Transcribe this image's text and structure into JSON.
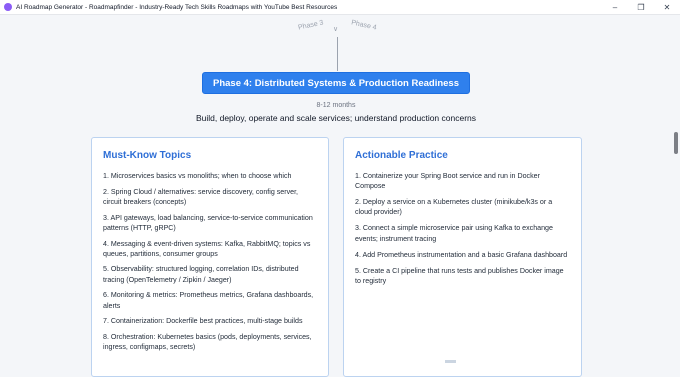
{
  "window": {
    "title": "AI Roadmap Generator - Roadmapfinder - Industry-Ready Tech Skills Roadmaps with YouTube Best Resources",
    "controls": {
      "minimize": "–",
      "maximize": "❐",
      "close": "✕"
    }
  },
  "phase_nav": {
    "previous": "Phase 3",
    "chevron": "∨",
    "next": "Phase 4"
  },
  "phase": {
    "title": "Phase 4: Distributed Systems & Production Readiness",
    "duration": "8-12 months",
    "summary": "Build, deploy, operate and scale services; understand production concerns"
  },
  "must_know": {
    "heading": "Must-Know Topics",
    "items": [
      "1. Microservices basics vs monoliths; when to choose which",
      "2. Spring Cloud / alternatives: service discovery, config server, circuit breakers (concepts)",
      "3. API gateways, load balancing, service-to-service communication patterns (HTTP, gRPC)",
      "4. Messaging & event-driven systems: Kafka, RabbitMQ; topics vs queues, partitions, consumer groups",
      "5. Observability: structured logging, correlation IDs, distributed tracing (OpenTelemetry / Zipkin / Jaeger)",
      "6. Monitoring & metrics: Prometheus metrics, Grafana dashboards, alerts",
      "7. Containerization: Dockerfile best practices, multi-stage builds",
      "8. Orchestration: Kubernetes basics (pods, deployments, services, ingress, configmaps, secrets)"
    ]
  },
  "practice": {
    "heading": "Actionable Practice",
    "items": [
      "1. Containerize your Spring Boot service and run in Docker Compose",
      "2. Deploy a service on a Kubernetes cluster (minikube/k3s or a cloud provider)",
      "3. Connect a simple microservice pair using Kafka to exchange events; instrument tracing",
      "4. Add Prometheus instrumentation and a basic Grafana dashboard",
      "5. Create a CI pipeline that runs tests and publishes Docker image to registry"
    ]
  },
  "colors": {
    "primary": "#2f80ed",
    "heading": "#2f6fd6",
    "card_border": "#bcd3f0"
  }
}
